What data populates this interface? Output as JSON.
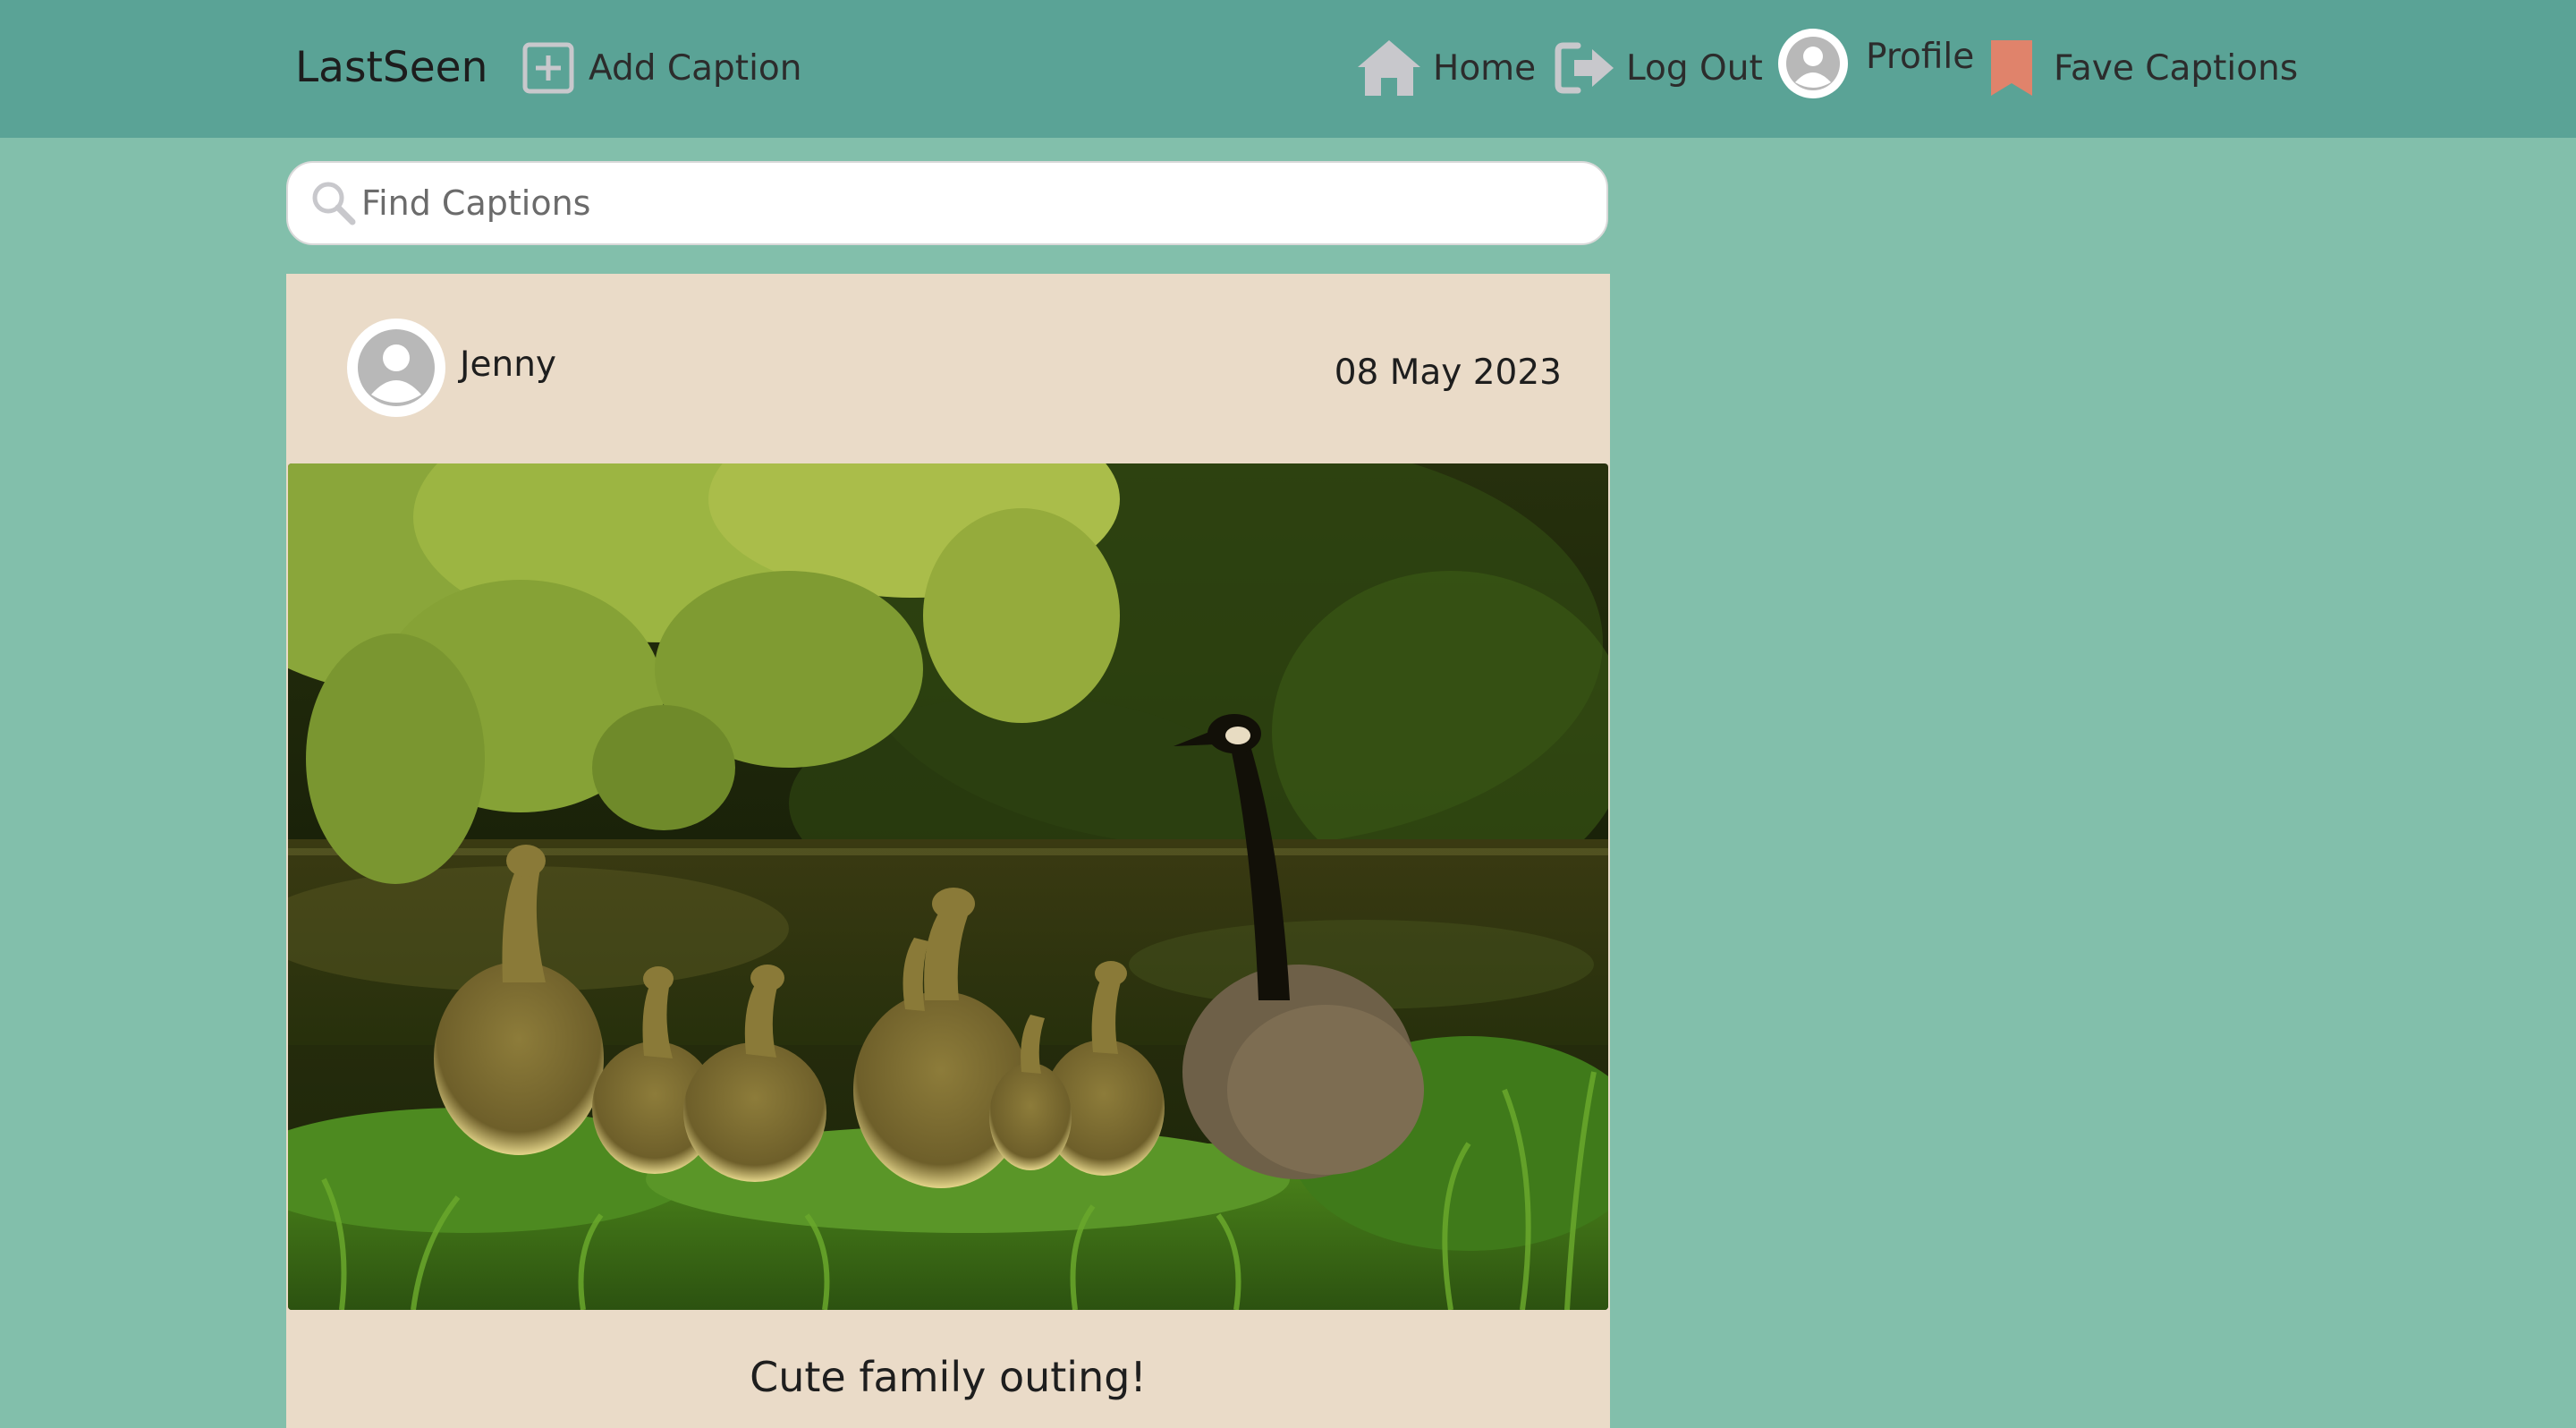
{
  "navbar": {
    "brand": "LastSeen",
    "add_caption": "Add Caption",
    "home": "Home",
    "log_out": "Log Out",
    "profile": "Profile",
    "fave_captions": "Fave Captions",
    "colors": {
      "bar": "#5aa396",
      "bookmark": "#e0836b",
      "icon_gray": "#c8c8cc"
    }
  },
  "search": {
    "placeholder": "Find Captions",
    "value": ""
  },
  "post": {
    "username": "Jenny",
    "date": "08 May 2023",
    "image_icon": "geese-family-photo",
    "caption": "Cute family outing!"
  },
  "colors": {
    "page_bg": "#82bfab",
    "card_bg": "#eadbc8"
  }
}
